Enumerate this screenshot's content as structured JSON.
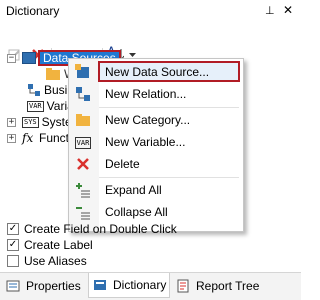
{
  "panel": {
    "title": "Dictionary",
    "pin_glyph": "⊥",
    "close_glyph": "✕"
  },
  "toolbar": {
    "items": [
      "edit-icon",
      "delete-icon",
      "move-up-icon",
      "move-down-icon",
      "sort-az-icon",
      "dropdown-icon"
    ],
    "sort_label": "AZ"
  },
  "tree": {
    "selected": "Data Sources",
    "items": [
      {
        "label": "Data Sources",
        "icon": "database-icon"
      },
      {
        "label": "W",
        "icon": "folder-icon"
      },
      {
        "label": "Busin",
        "icon": "business-object-icon"
      },
      {
        "label": "Varia",
        "icon": "variable-icon"
      },
      {
        "label": "Syste",
        "icon": "system-variable-icon"
      },
      {
        "label": "Funct",
        "icon": "function-icon",
        "glyph": "fx"
      }
    ]
  },
  "context_menu": {
    "items": [
      {
        "label": "New Data Source...",
        "icon": "new-datasource-icon"
      },
      {
        "label": "New Relation...",
        "icon": "new-relation-icon"
      },
      {
        "label": "New Category...",
        "icon": "new-category-icon"
      },
      {
        "label": "New Variable...",
        "icon": "new-variable-icon"
      },
      {
        "label": "Delete",
        "icon": "delete-icon"
      },
      {
        "label": "Expand All",
        "icon": "expand-all-icon"
      },
      {
        "label": "Collapse All",
        "icon": "collapse-all-icon"
      }
    ]
  },
  "options": [
    {
      "label": "Create Field on Double Click",
      "checked": true
    },
    {
      "label": "Create Label",
      "checked": true
    },
    {
      "label": "Use Aliases",
      "checked": false
    }
  ],
  "tabs": [
    {
      "label": "Properties",
      "icon": "properties-icon",
      "active": false
    },
    {
      "label": "Dictionary",
      "icon": "dictionary-icon",
      "active": true
    },
    {
      "label": "Report Tree",
      "icon": "report-tree-icon",
      "active": false
    }
  ],
  "colors": {
    "selection": "#1f78d1",
    "highlight_border": "#b11c25",
    "delete_red": "#d9302c",
    "category_yellow": "#f1b33f"
  }
}
